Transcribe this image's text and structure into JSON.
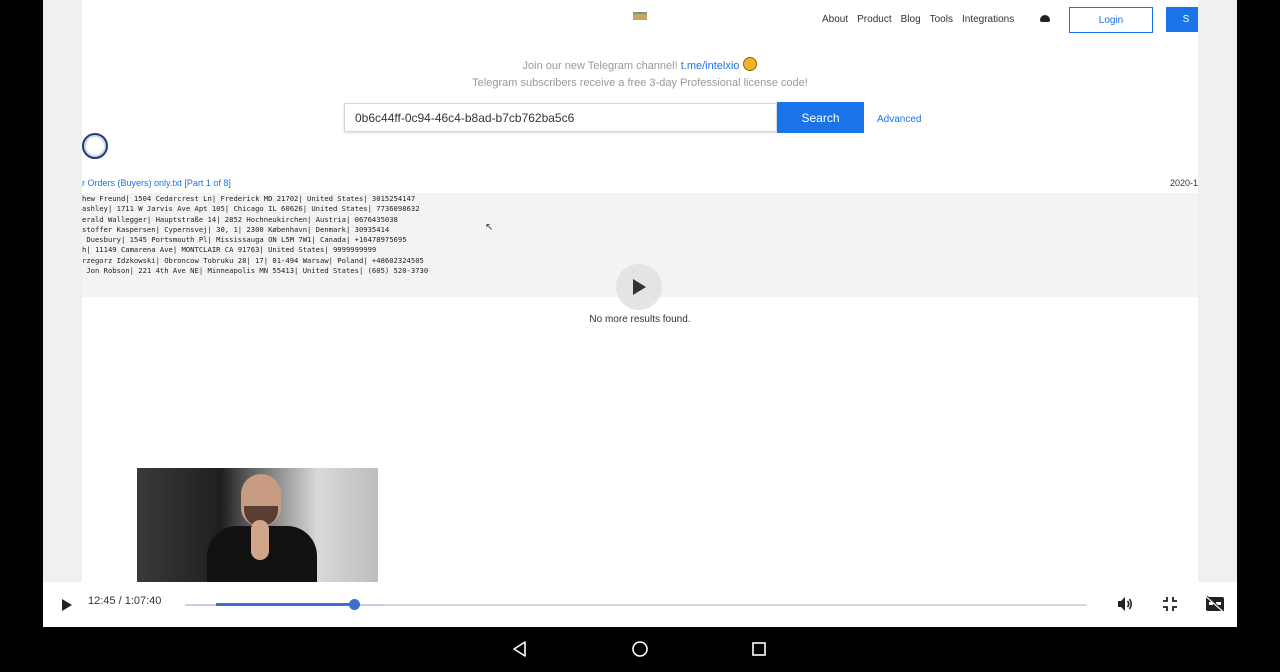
{
  "site": {
    "nav": [
      "About",
      "Product",
      "Blog",
      "Tools",
      "Integrations"
    ],
    "login_label": "Login",
    "signup_label": "S",
    "promo_text": "Join our new Telegram channel!",
    "promo_link": "t.me/intelxio",
    "promo_line2": "Telegram subscribers receive a free 3-day Professional license code!",
    "search_value": "0b6c44ff-0c94-46c4-b8ad-b7cb762ba5c6",
    "search_label": "Search",
    "advanced_label": "Advanced",
    "result_title": "r Orders (Buyers) only.txt [Part 1 of 8]",
    "result_date": "2020-1",
    "result_lines": [
      "hew Freund| 1504 Cedarcrest Ln| Frederick MD 21702| United States| 3015254147",
      "ashley| 1711 W Jarvis Ave Apt 105| Chicago IL 60626| United States| 7736098632",
      "erald Wallegger| Hauptstraße 14| 2852 Hochneukirchen| Austria| 0676435038",
      "stoffer Kaspersen| Cypernsvej| 30, 1| 2300 København| Denmark| 30935414",
      " Duesbury| 1545 Portsmouth Pl| Mississauga ON L5M 7W1| Canada| +16478975695",
      "h| 11149 Camarena Ave| MONTCLAIR CA 91763| United States| 9999999999",
      "rzegorz Idzkowski| Obroncow Tobruku 28| 17| 01-494 Warsaw| Poland| +48602324505",
      " Jon Robson| 221 4th Ave NE| Minneapolis MN 55413| United States| (605) 520-3730"
    ],
    "no_more": "No more results found."
  },
  "player": {
    "time": "12:45 / 1:07:40",
    "progress": 0.1885
  },
  "icons": {
    "play": "play-icon",
    "volume": "volume-icon",
    "exit_fullscreen": "exit-fullscreen-icon",
    "captions_off": "captions-off-icon",
    "back": "back-icon",
    "home": "home-icon",
    "recents": "recents-icon"
  }
}
